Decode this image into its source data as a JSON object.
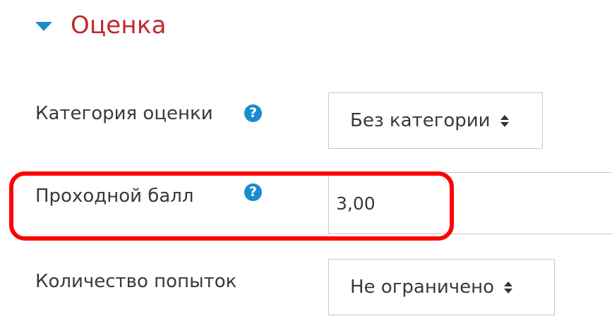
{
  "section": {
    "title": "Оценка"
  },
  "fields": {
    "grade_category": {
      "label": "Категория оценки",
      "value": "Без категории",
      "help_icon": "question-circle-icon"
    },
    "passing_grade": {
      "label": "Проходной балл",
      "value": "3,00",
      "help_icon": "question-circle-icon"
    },
    "attempts": {
      "label": "Количество попыток",
      "value": "Не ограничено"
    }
  },
  "colors": {
    "section_title": "#c1272d",
    "caret": "#1b8bd0",
    "help_icon": "#1b8bd0",
    "highlight": "#ff0000",
    "border": "#c7c7c7"
  }
}
